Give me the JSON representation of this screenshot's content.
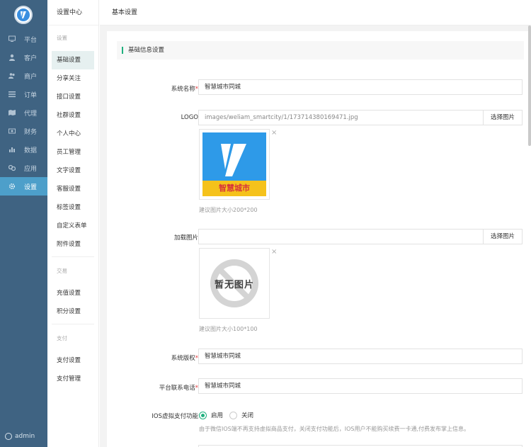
{
  "sidebar": {
    "items": [
      {
        "label": "平台",
        "icon": "monitor-icon"
      },
      {
        "label": "客户",
        "icon": "user-icon"
      },
      {
        "label": "商户",
        "icon": "users-icon"
      },
      {
        "label": "订单",
        "icon": "list-icon"
      },
      {
        "label": "代理",
        "icon": "map-icon"
      },
      {
        "label": "财务",
        "icon": "money-icon"
      },
      {
        "label": "数据",
        "icon": "chart-icon"
      },
      {
        "label": "应用",
        "icon": "apps-icon"
      },
      {
        "label": "设置",
        "icon": "gear-icon"
      }
    ],
    "user": "admin"
  },
  "submenu": {
    "title": "设置中心",
    "group1": {
      "title": "设置",
      "items": [
        "基础设置",
        "分享关注",
        "接口设置",
        "社群设置",
        "个人中心",
        "员工管理",
        "文字设置",
        "客服设置",
        "标签设置",
        "自定义表单",
        "附件设置"
      ]
    },
    "group2": {
      "title": "交易",
      "items": [
        "充值设置",
        "积分设置"
      ]
    },
    "group3": {
      "title": "支付",
      "items": [
        "支付设置",
        "支付管理"
      ]
    }
  },
  "header": {
    "title": "基本设置"
  },
  "panel": {
    "title": "基础信息设置"
  },
  "form": {
    "site_name": {
      "label": "系统名称",
      "value": "智慧城市同城"
    },
    "logo": {
      "label": "LOGO",
      "value": "images/weliam_smartcity/1/173714380169471.jpg",
      "button": "选择图片",
      "logo_text": "智慧城市",
      "hint": "建议图片大小200*200"
    },
    "loading": {
      "label": "加载图片",
      "value": "",
      "button": "选择图片",
      "placeholder_text": "暂无图片",
      "hint": "建议图片大小100*100"
    },
    "copyright": {
      "label": "系统版权",
      "value": "智慧城市同城"
    },
    "phone": {
      "label": "平台联系电话",
      "value": "智慧城市同城"
    },
    "ios_pay": {
      "label": "IOS虚拟支付功能",
      "options": [
        "启用",
        "关闭"
      ],
      "selected": "启用",
      "note": "由于微信IOS端不再支持虚拟商品支付，关闭支付功能后，IOS用户不能购买续费一卡通,付费发布掌上信息。"
    },
    "required_mark": "*",
    "close_mark": "×"
  },
  "colors": {
    "sidebar": "#3f6382",
    "active": "#4d9fca",
    "accent": "#1fb07e",
    "required": "#e4393c"
  }
}
